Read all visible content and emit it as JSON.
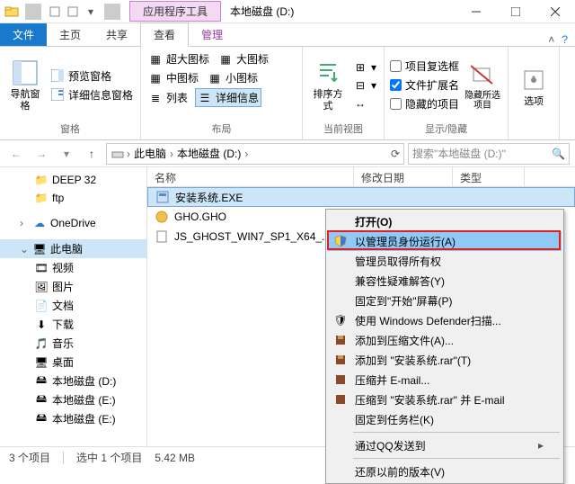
{
  "title_contextual": "应用程序工具",
  "title_main": "本地磁盘 (D:)",
  "tabs": {
    "file": "文件",
    "home": "主页",
    "share": "共享",
    "view": "查看",
    "manage": "管理"
  },
  "ribbon": {
    "nav_btn": "导航窗格",
    "preview": "预览窗格",
    "details_pane": "详细信息窗格",
    "panes_label": "窗格",
    "extra_large": "超大图标",
    "large": "大图标",
    "medium": "中图标",
    "small": "小图标",
    "list": "列表",
    "details_view": "详细信息",
    "layout_label": "布局",
    "sort": "排序方式",
    "current_label": "当前视图",
    "cb_checkboxes": "项目复选框",
    "cb_ext": "文件扩展名",
    "cb_hidden": "隐藏的项目",
    "hide_sel": "隐藏所选项目",
    "showhide_label": "显示/隐藏",
    "options": "选项"
  },
  "breadcrumb": {
    "pc": "此电脑",
    "drive": "本地磁盘 (D:)"
  },
  "search_placeholder": "搜索\"本地磁盘 (D:)\"",
  "tree": {
    "deep32": "DEEP 32",
    "ftp": "ftp",
    "onedrive": "OneDrive",
    "thispc": "此电脑",
    "videos": "视频",
    "pictures": "图片",
    "documents": "文档",
    "downloads": "下载",
    "music": "音乐",
    "desktop": "桌面",
    "drive_d": "本地磁盘 (D:)",
    "drive_e": "本地磁盘 (E:)"
  },
  "list": {
    "col_name": "名称",
    "col_date": "修改日期",
    "col_type": "类型",
    "rows": [
      {
        "name": "安装系统.EXE"
      },
      {
        "name": "GHO.GHO"
      },
      {
        "name": "JS_GHOST_WIN7_SP1_X64_..."
      }
    ]
  },
  "ctx": {
    "open": "打开(O)",
    "runas": "以管理员身份运行(A)",
    "admin_all": "管理员取得所有权",
    "compat": "兼容性疑难解答(Y)",
    "pin_start": "固定到\"开始\"屏幕(P)",
    "defender": "使用 Windows Defender扫描...",
    "add_rar": "添加到压缩文件(A)...",
    "add_rar_named": "添加到 \"安装系统.rar\"(T)",
    "email": "压缩并 E-mail...",
    "email_named": "压缩到 \"安装系统.rar\" 并 E-mail",
    "pin_taskbar": "固定到任务栏(K)",
    "sendqq": "通过QQ发送到",
    "restore": "还原以前的版本(V)"
  },
  "status": {
    "count": "3 个项目",
    "selected": "选中 1 个项目",
    "size": "5.42 MB"
  }
}
